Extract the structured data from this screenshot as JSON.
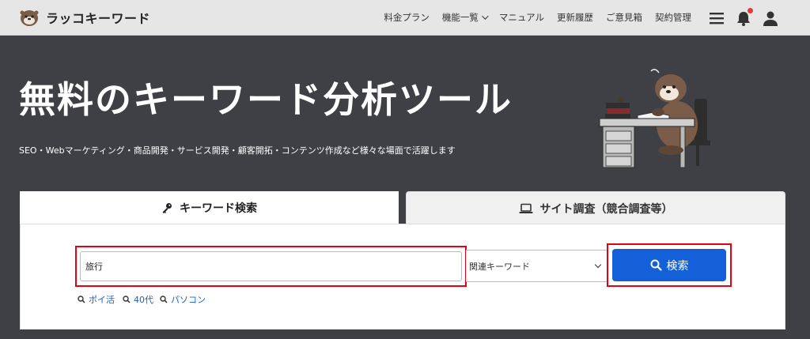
{
  "header": {
    "logo_text": "ラッコキーワード",
    "nav": [
      "料金プラン",
      "機能一覧",
      "マニュアル",
      "更新履歴",
      "ご意見箱",
      "契約管理"
    ]
  },
  "hero": {
    "title": "無料のキーワード分析ツール",
    "subtitle": "SEO・Webマーケティング・商品開発・サービス開発・顧客開拓・コンテンツ作成など様々な場面で活躍します"
  },
  "tabs": {
    "keyword": "キーワード検索",
    "site": "サイト調査（競合調査等）"
  },
  "search": {
    "value": "旅行",
    "mode": "関連キーワード",
    "button": "検索",
    "suggestions": [
      "ポイ活",
      "40代",
      "パソコン"
    ]
  },
  "colors": {
    "header_bg": "#e6e6e6",
    "hero_bg": "#3f3f46",
    "button_blue": "#1360d8",
    "highlight_red": "#e50012",
    "link_blue": "#1a5fc8",
    "notification_red": "#e53935"
  },
  "icons": {
    "logo": "otter-logo-icon",
    "menu": "hamburger-icon",
    "bell": "bell-icon",
    "user": "user-icon",
    "key": "key-icon",
    "laptop": "laptop-icon",
    "search": "search-icon"
  }
}
